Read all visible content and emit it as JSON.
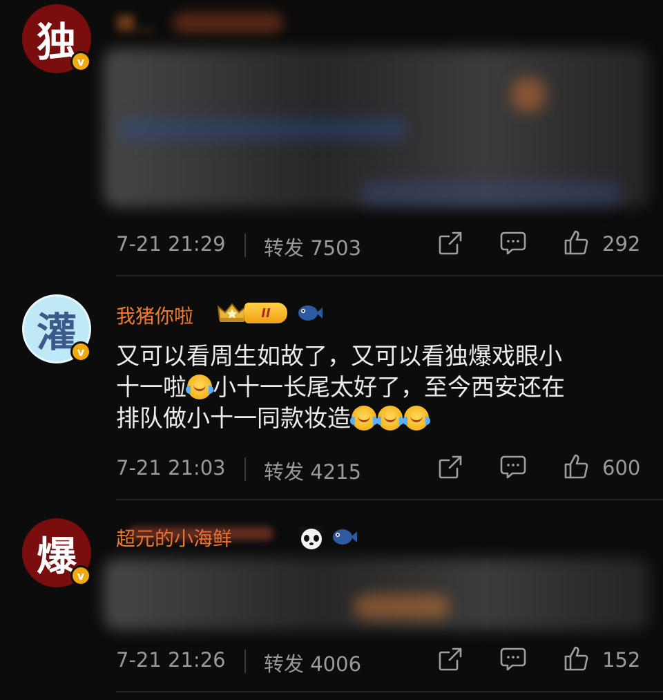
{
  "posts": [
    {
      "avatar_char": "独",
      "verified": "v",
      "username": "转…",
      "content": "",
      "time": "7-21 21:29",
      "repost_label": "转发",
      "repost_count": "7503",
      "likes": "292"
    },
    {
      "avatar_char": "灌",
      "verified": "v",
      "username": "我猪你啦",
      "rank_badge": "II",
      "content_line1": "又可以看周生如故了，又可以看独爆戏眼小",
      "content_line2a": "十一啦",
      "content_line2b": "小十一长尾太好了，至今西安还在",
      "content_line3": "排队做小十一同款妆造",
      "time": "7-21 21:03",
      "repost_label": "转发",
      "repost_count": "4215",
      "likes": "600"
    },
    {
      "avatar_char": "爆",
      "verified": "v",
      "username": "超元的小海鲜",
      "content": "",
      "time": "7-21 21:26",
      "repost_label": "转发",
      "repost_count": "4006",
      "likes": "152"
    }
  ],
  "icons": {
    "share": "share-icon",
    "comment": "comment-icon",
    "like": "thumbs-up-icon",
    "emoji": "crying-laughing-emoji"
  },
  "colors": {
    "background": "#0c0c0c",
    "username": "#f07a2a",
    "meta": "#9a9a9a",
    "verified": "#f3a90b"
  }
}
